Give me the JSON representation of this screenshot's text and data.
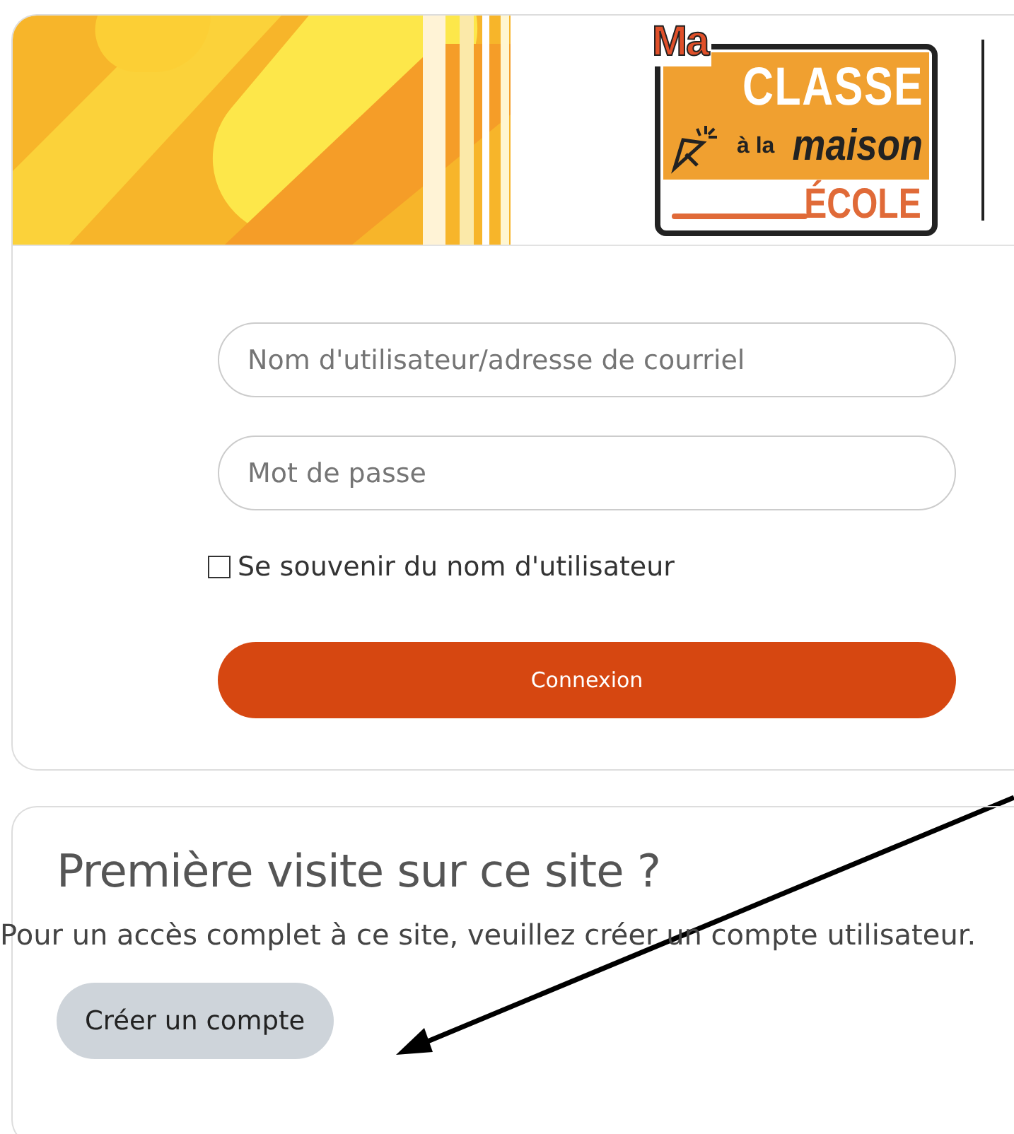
{
  "logo": {
    "texts": [
      "Ma",
      "CLASSE",
      "à la",
      "maison",
      "ÉCOLE"
    ]
  },
  "login": {
    "fields": [
      {
        "placeholder": "Nom d'utilisateur/adresse de courriel"
      },
      {
        "placeholder": "Mot de passe"
      }
    ],
    "remember": {
      "label": "Se souvenir du nom d'utilisateur",
      "checked": false
    },
    "submit": "Connexion"
  },
  "signup": {
    "title": "Première visite sur ce site ?",
    "text": "Pour un accès complet à ce site, veuillez créer un compte utilisateur.",
    "button": "Créer un compte"
  }
}
